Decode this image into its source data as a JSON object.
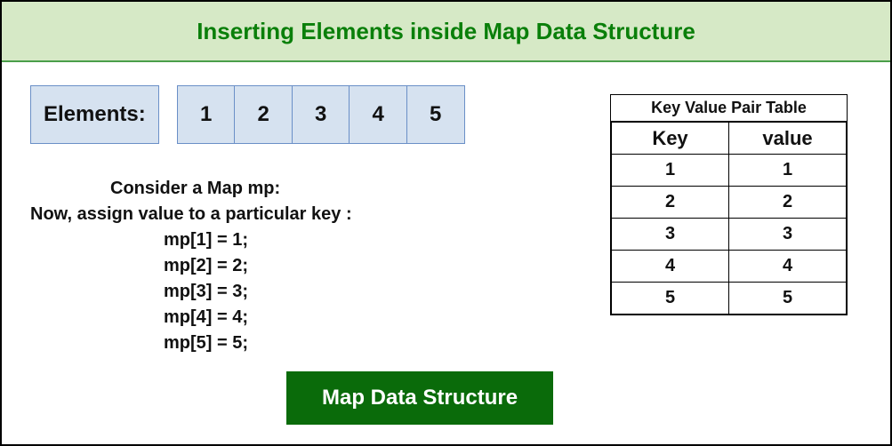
{
  "header": {
    "title": "Inserting Elements inside Map Data Structure"
  },
  "elements": {
    "label": "Elements:",
    "items": [
      "1",
      "2",
      "3",
      "4",
      "5"
    ]
  },
  "description": {
    "line1": "Consider a Map mp:",
    "line2": "Now, assign value to a particular key :",
    "assigns": [
      "mp[1] = 1;",
      "mp[2] = 2;",
      "mp[3] =  3;",
      "mp[4] = 4;",
      "mp[5] = 5;"
    ]
  },
  "footer": {
    "label": "Map Data Structure"
  },
  "kvtable": {
    "caption": "Key Value Pair Table",
    "headers": {
      "key": "Key",
      "value": "value"
    },
    "rows": [
      {
        "k": "1",
        "v": "1"
      },
      {
        "k": "2",
        "v": "2"
      },
      {
        "k": "3",
        "v": "3"
      },
      {
        "k": "4",
        "v": "4"
      },
      {
        "k": "5",
        "v": "5"
      }
    ]
  }
}
